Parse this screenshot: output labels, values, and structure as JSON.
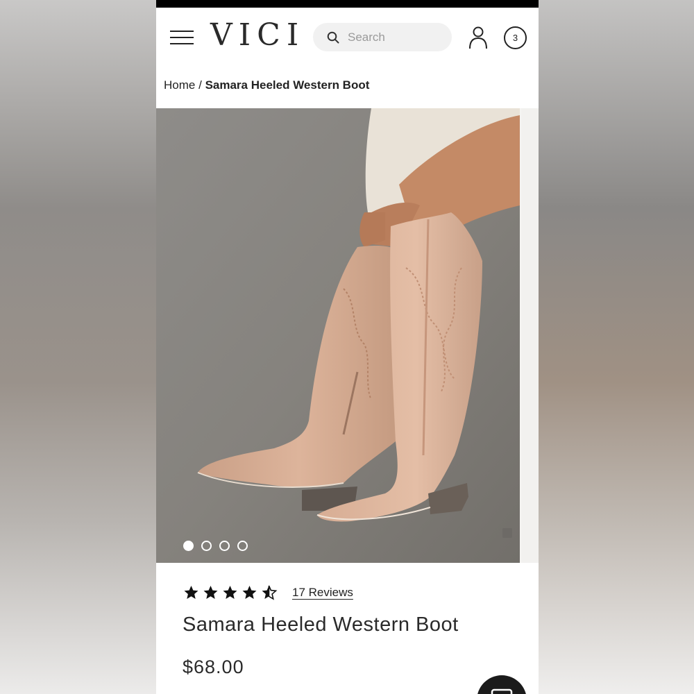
{
  "header": {
    "brand": "VICI",
    "search_placeholder": "Search",
    "cart_count": "3"
  },
  "breadcrumb": {
    "home": "Home",
    "separator": "/",
    "current": "Samara Heeled Western Boot"
  },
  "gallery": {
    "image_count": 4,
    "active_index": 0
  },
  "product": {
    "rating": 4.5,
    "rating_max": 5,
    "reviews": "17 Reviews",
    "title": "Samara Heeled Western Boot",
    "price": "$68.00"
  },
  "icons": {
    "menu": "hamburger-menu-icon",
    "search": "search-icon",
    "account": "user-icon",
    "chat": "chat-icon"
  }
}
